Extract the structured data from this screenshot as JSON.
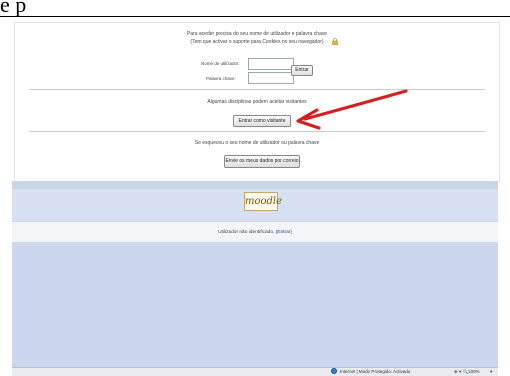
{
  "doc": {
    "title": "e p"
  },
  "login": {
    "info_line1": "Para aceder precisa do seu nome de utilizador e palavra chave",
    "info_line2": "(Tem que activar o suporte para Cookies no seu navegador)",
    "username_label": "Nome de utilizador:",
    "password_label": "Palavra chave:",
    "username_value": "",
    "password_value": "",
    "login_button": "Entrar",
    "guest_info": "Algumas disciplinas podem aceitar visitantes",
    "guest_button": "Entrar como visitante",
    "forgot_info": "Se esqueceu o seu nome de utilizador ou palavra chave",
    "email_button": "Envie os meus dados por correio"
  },
  "annotation": {
    "arrow_color": "#d42020"
  },
  "footer": {
    "logo_text": "moodle",
    "not_identified_text": "Utilizador não identificado.",
    "login_link": "(Entrar)"
  },
  "statusbar": {
    "status_text": "Internet | Modo Protegido: Activado",
    "zoom_text": "⊕ ▾  🔍100%",
    "zoom_arrow": "▾"
  },
  "icons": [
    "lock-icon",
    "globe-icon",
    "red-arrow"
  ],
  "colors": {
    "band": "#d7e0f0",
    "blank_area": "#ccd7ee",
    "link": "#1a3c9a"
  }
}
